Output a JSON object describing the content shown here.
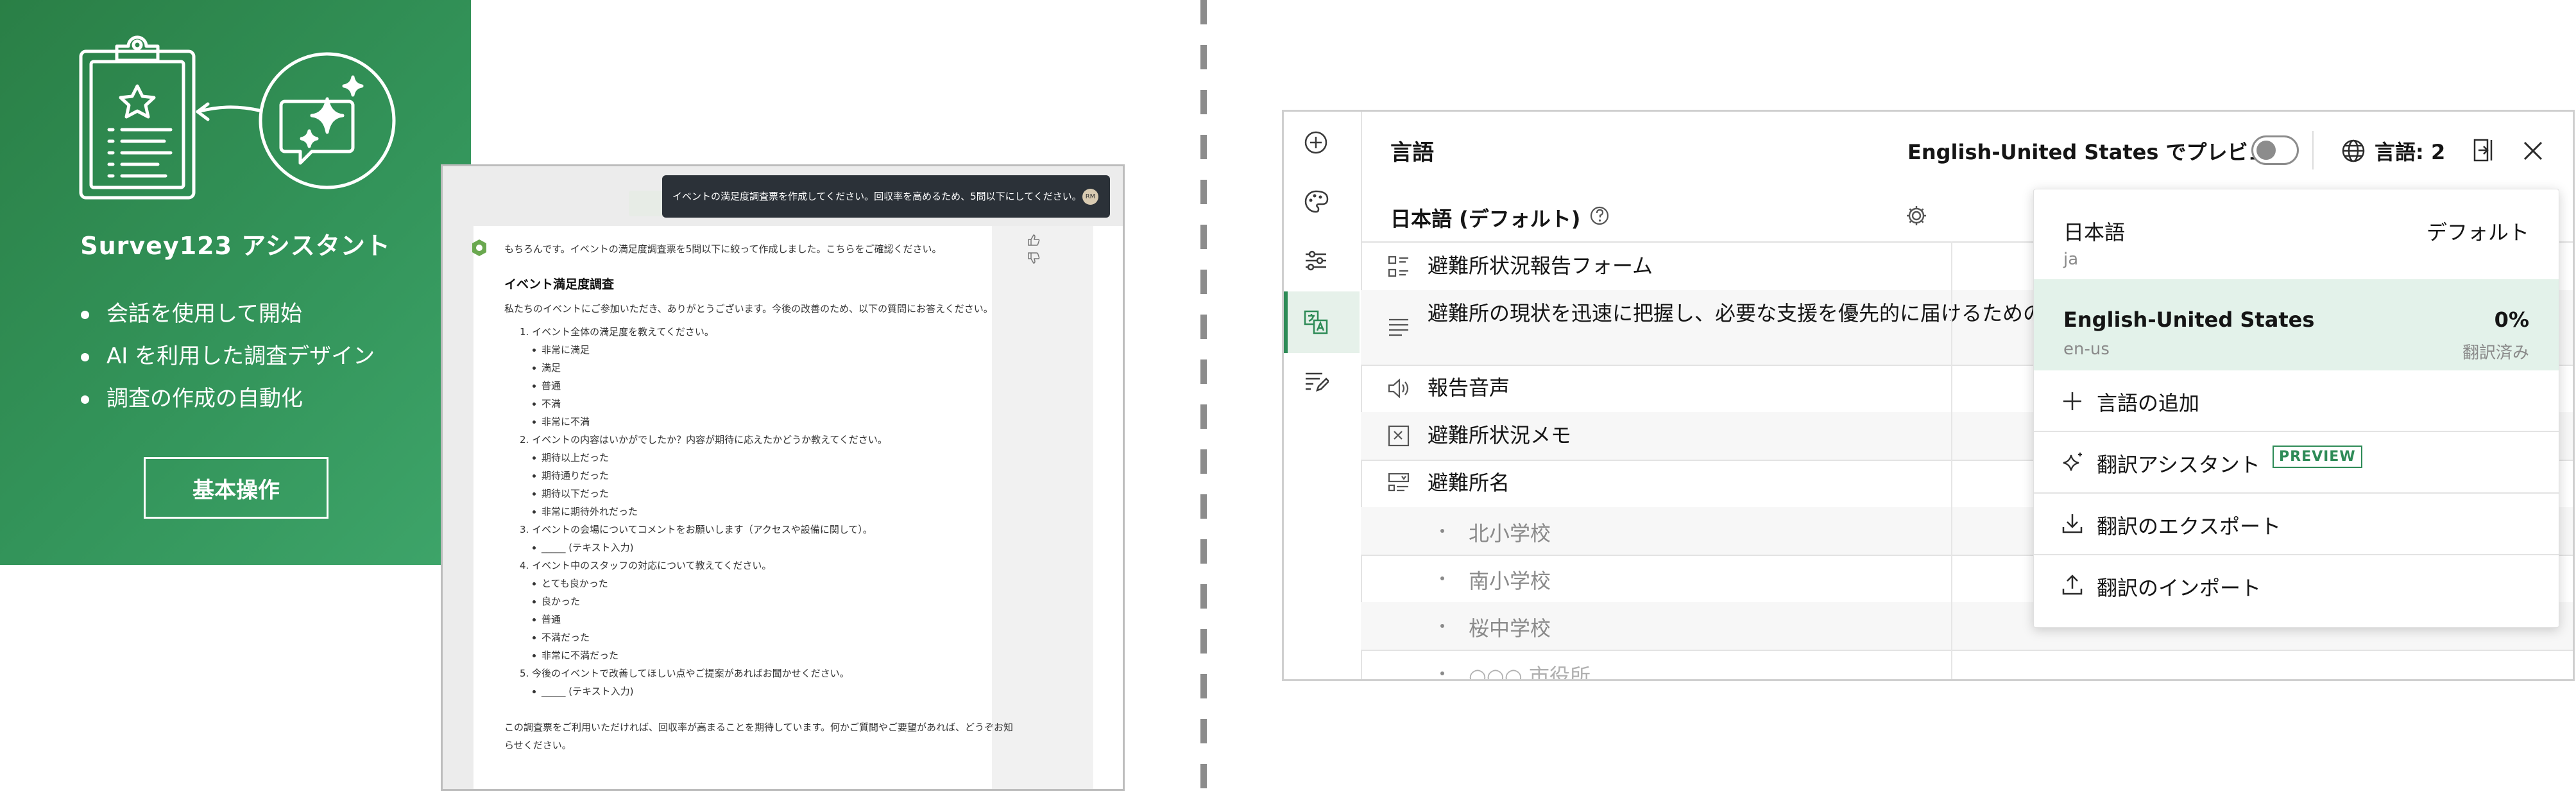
{
  "promo": {
    "title": "Survey123 アシスタント",
    "items": [
      "会話を使用して開始",
      "AI を利用した調査デザイン",
      "調査の作成の自動化"
    ],
    "button": "基本操作",
    "icons": [
      "clipboard-survey-icon",
      "ai-chat-sparkle-icon"
    ],
    "color": "#2f8b4f"
  },
  "chat": {
    "prompt": "イベントの満足度調査票を作成してください。回収率を高めるため、5問以下にしてください。",
    "avatar": "RM",
    "intro": "もちろんです。イベントの満足度調査票を5問以下に絞って作成しました。こちらをご確認ください。",
    "survey_title": "イベント満足度調査",
    "survey_desc": "私たちのイベントにご参加いただき、ありがとうございます。今後の改善のため、以下の質問にお答えください。",
    "questions": [
      {
        "q": "1. イベント全体の満足度を教えてください。",
        "options": [
          "非常に満足",
          "満足",
          "普通",
          "不満",
          "非常に不満"
        ]
      },
      {
        "q": "2. イベントの内容はいかがでしたか？内容が期待に応えたかどうか教えてください。",
        "options": [
          "期待以上だった",
          "期待通りだった",
          "期待以下だった",
          "非常に期待外れだった"
        ]
      },
      {
        "q": "3. イベントの会場についてコメントをお願いします（アクセスや設備に関して）。",
        "options": [
          "_____ (テキスト入力)"
        ]
      },
      {
        "q": "4. イベント中のスタッフの対応について教えてください。",
        "options": [
          "とても良かった",
          "良かった",
          "普通",
          "不満だった",
          "非常に不満だった"
        ]
      },
      {
        "q": "5. 今後のイベントで改善してほしい点やご提案があればお聞かせください。",
        "options": [
          "_____ (テキスト入力)"
        ]
      }
    ],
    "closing": "この調査票をご利用いただければ、回収率が高まることを期待しています。何かご質問やご要望があれば、どうぞお知らせください。"
  },
  "panel": {
    "title": "言語",
    "preview_label": "English-United States でプレビュー",
    "preview_on": false,
    "language_count": "言語: 2",
    "default_language": "日本語 (デフォルト)",
    "rows": [
      {
        "icon": "form-icon",
        "text": "避難所状況報告フォーム"
      },
      {
        "icon": "description-icon",
        "text": "避難所の現状を迅速に把握し、必要な支援を優先的に届けるための報告フォームです。"
      },
      {
        "icon": "audio-icon",
        "text": "報告音声"
      },
      {
        "icon": "note-icon",
        "text": "避難所状況メモ"
      },
      {
        "icon": "dropdown-question-icon",
        "text": "避難所名"
      },
      {
        "text": "北小学校"
      },
      {
        "text": "南小学校"
      },
      {
        "text": "桜中学校"
      },
      {
        "text": "○○○ 市役所"
      }
    ],
    "dropdown": {
      "languages": [
        {
          "name": "日本語",
          "code": "ja",
          "status": "デフォルト"
        },
        {
          "name": "English-United States",
          "code": "en-us",
          "percent": "0%",
          "status": "翻訳済み"
        }
      ],
      "actions": [
        {
          "icon": "plus-icon",
          "label": "言語の追加"
        },
        {
          "icon": "sparkle-icon",
          "label": "翻訳アシスタント",
          "badge": "PREVIEW"
        },
        {
          "icon": "download-icon",
          "label": "翻訳のエクスポート"
        },
        {
          "icon": "upload-icon",
          "label": "翻訳のインポート"
        }
      ]
    },
    "accent": "#2e8b57"
  }
}
